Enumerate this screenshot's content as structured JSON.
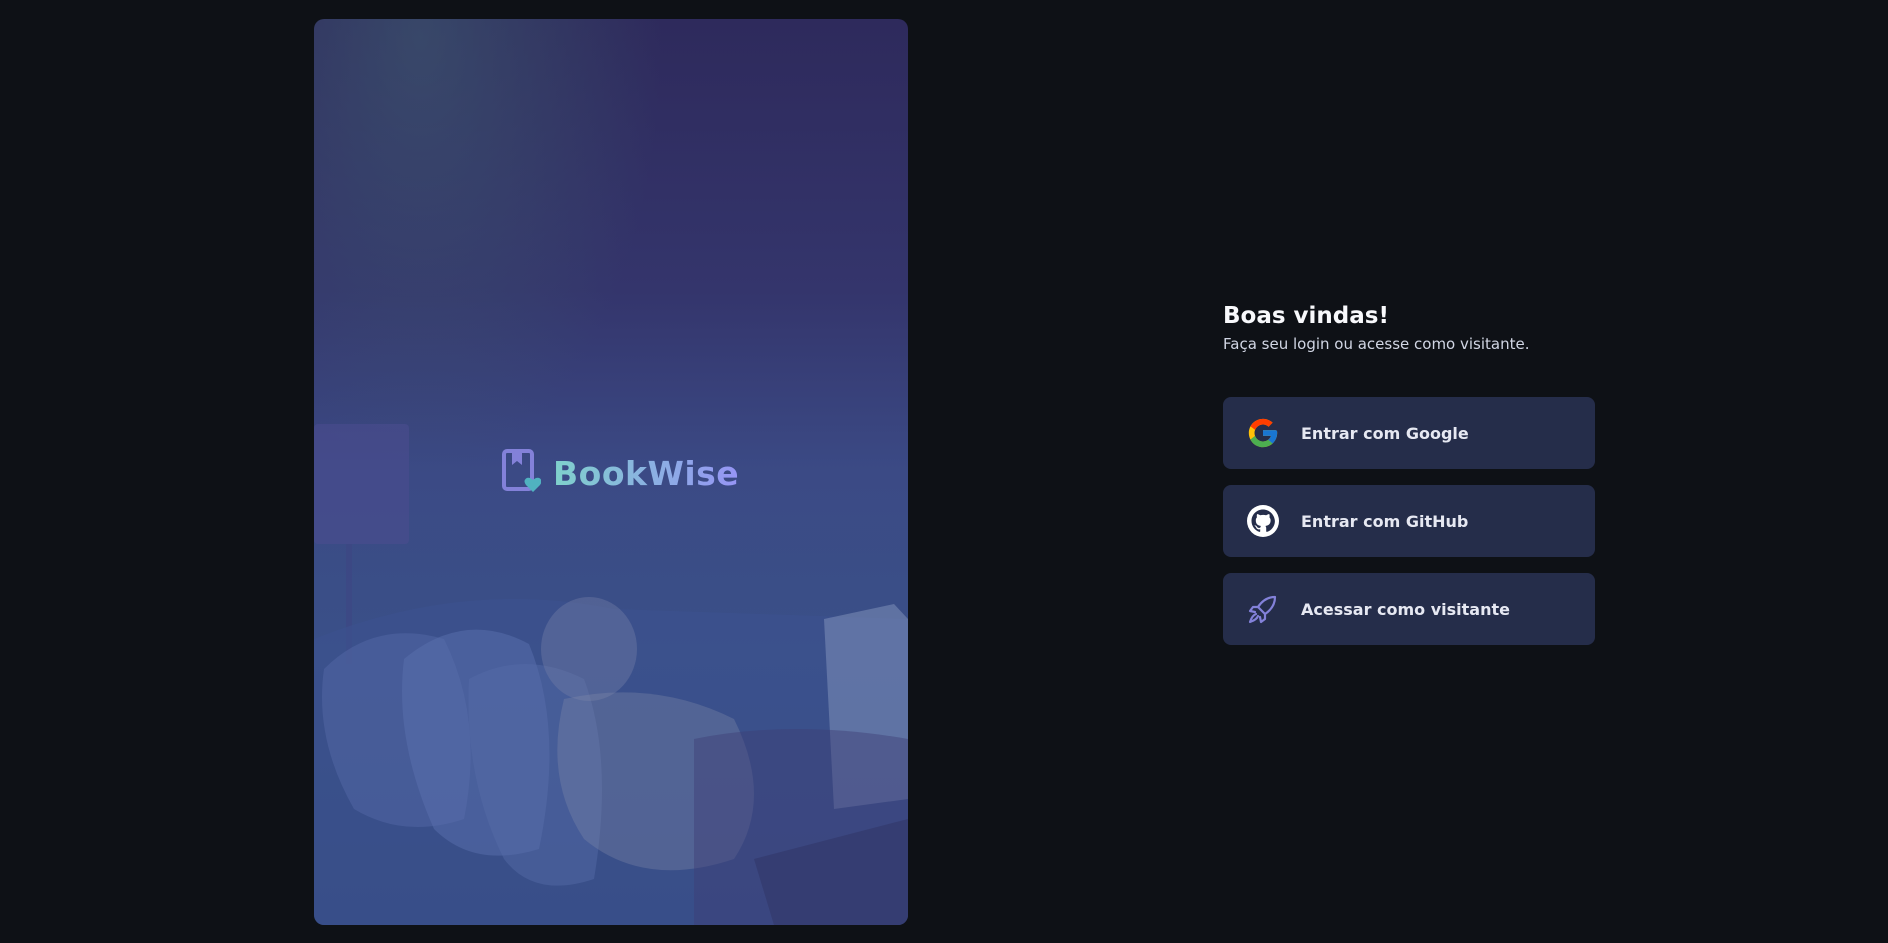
{
  "brand": {
    "name": "BookWise",
    "gradient_start": "#7fd1cc",
    "gradient_end": "#9694f5"
  },
  "welcome": {
    "title": "Boas vindas!",
    "subtitle": "Faça seu login ou acesse como visitante."
  },
  "buttons": [
    {
      "label": "Entrar com Google",
      "icon": "google-icon"
    },
    {
      "label": "Entrar com GitHub",
      "icon": "github-icon"
    },
    {
      "label": "Acessar como visitante",
      "icon": "rocket-icon"
    }
  ],
  "colors": {
    "background": "#0e1116",
    "button_bg": "#252d4a",
    "accent": "#8381d9"
  }
}
